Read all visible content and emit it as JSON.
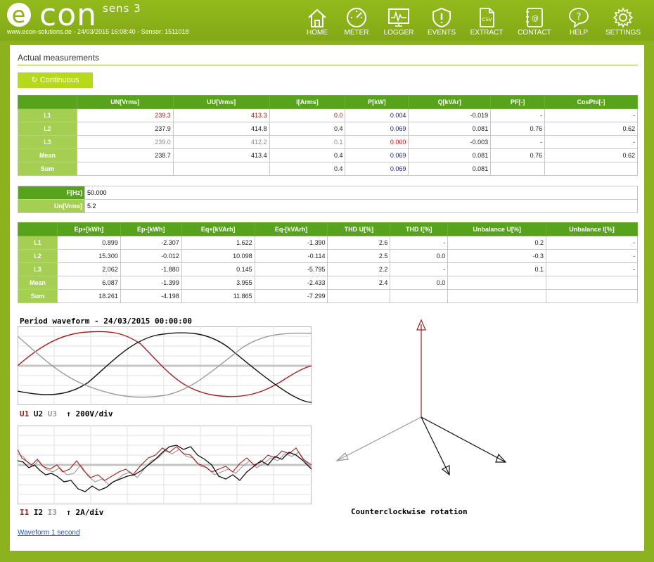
{
  "app": {
    "logo": "econ",
    "logo_sub": "sens 3",
    "info_line": "www.econ-solutions.de - 24/03/2015 16:08:40 - Sensor: 1511018"
  },
  "nav": [
    {
      "label": "HOME",
      "icon": "home-icon"
    },
    {
      "label": "METER",
      "icon": "meter-icon"
    },
    {
      "label": "LOGGER",
      "icon": "logger-icon"
    },
    {
      "label": "EVENTS",
      "icon": "events-icon"
    },
    {
      "label": "EXTRACT",
      "icon": "extract-icon",
      "icon_text": "CSV"
    },
    {
      "label": "CONTACT",
      "icon": "contact-icon"
    },
    {
      "label": "HELP",
      "icon": "help-icon"
    },
    {
      "label": "SETTINGS",
      "icon": "settings-icon"
    }
  ],
  "main": {
    "title": "Actual measurements",
    "continuous_button": "Continuous",
    "continuous_icon": "refresh-icon"
  },
  "table1": {
    "headers": [
      "",
      "UN[Vrms]",
      "UU[Vrms]",
      "I[Arms]",
      "P[kW]",
      "Q[kVAr]",
      "PF[-]",
      "CosPhi[-]"
    ],
    "rows": [
      [
        "L1",
        "239.3",
        "413.3",
        "0.0",
        "0.004",
        "-0.019",
        "-",
        "-"
      ],
      [
        "L2",
        "237.9",
        "414.8",
        "0.4",
        "0.069",
        "0.081",
        "0.76",
        "0.62"
      ],
      [
        "L3",
        "239.0",
        "412.2",
        "0.1",
        "0.000",
        "-0.003",
        "-",
        "-"
      ],
      [
        "Mean",
        "238.7",
        "413.4",
        "0.4",
        "0.069",
        "0.081",
        "0.76",
        "0.62"
      ],
      [
        "Sum",
        "",
        "",
        "0.4",
        "0.069",
        "0.081",
        "",
        ""
      ]
    ]
  },
  "freq": {
    "f_label": "F[Hz]",
    "f_value": "50.000",
    "un_label": "Un[Vrms]",
    "un_value": "5.2"
  },
  "table2": {
    "headers": [
      "",
      "Ep+[kWh]",
      "Ep-[kWh]",
      "Eq+[kVArh]",
      "Eq-[kVArh]",
      "THD U[%]",
      "THD I[%]",
      "Unbalance U[%]",
      "Unbalance I[%]"
    ],
    "rows": [
      [
        "L1",
        "0.899",
        "-2.307",
        "1.622",
        "-1.390",
        "2.6",
        "-",
        "0.2",
        "-"
      ],
      [
        "L2",
        "15.300",
        "-0.012",
        "10.098",
        "-0.114",
        "2.5",
        "0.0",
        "-0.3",
        "-"
      ],
      [
        "L3",
        "2.062",
        "-1.880",
        "0.145",
        "-5.795",
        "2.2",
        "-",
        "0.1",
        "-"
      ],
      [
        "Mean",
        "6.087",
        "-1.399",
        "3.955",
        "-2.433",
        "2.4",
        "0.0",
        "",
        ""
      ],
      [
        "Sum",
        "18.261",
        "-4.198",
        "11.865",
        "-7.299",
        "",
        "",
        "",
        ""
      ]
    ]
  },
  "waveform": {
    "title": "Period waveform - 24/03/2015 00:00:00",
    "u_labels": [
      "U1",
      "U2",
      "U3"
    ],
    "u_scale": "200V/div",
    "i_labels": [
      "I1",
      "I2",
      "I3"
    ],
    "i_scale": "2A/div",
    "colors": {
      "phase1": "#a81c1c",
      "phase2": "#111111",
      "phase3": "#9a9a9a"
    },
    "rotation_label": "Counterclockwise rotation",
    "link": "Waveform 1 second"
  }
}
